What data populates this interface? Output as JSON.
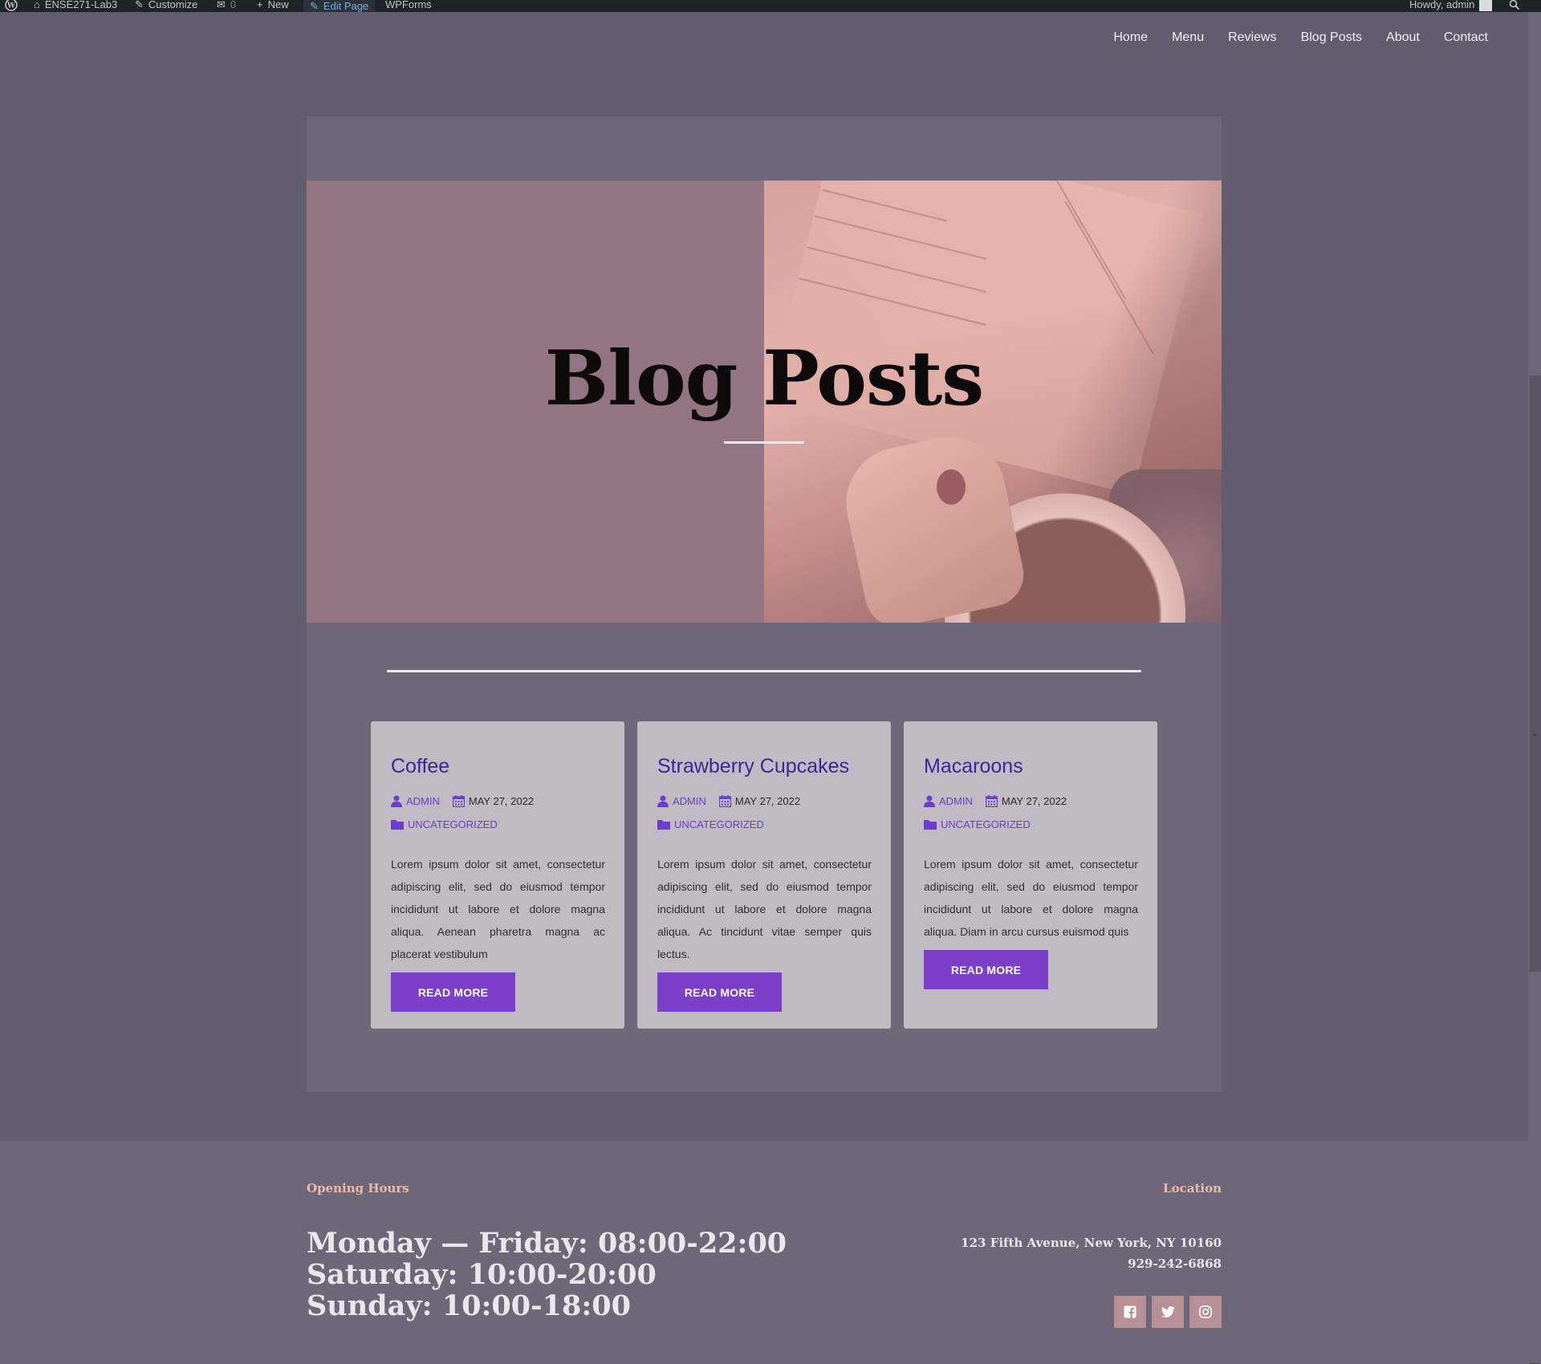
{
  "admin_bar": {
    "site_name": "ENSE271-Lab3",
    "customize": "Customize",
    "comments_count": "0",
    "new_label": "New",
    "edit_page": "Edit Page",
    "wpforms": "WPForms",
    "howdy": "Howdy, admin"
  },
  "nav": {
    "items": [
      "Home",
      "Menu",
      "Reviews",
      "Blog Posts",
      "About",
      "Contact"
    ]
  },
  "hero": {
    "title": "Blog Posts"
  },
  "posts": [
    {
      "title": "Coffee",
      "author": "ADMIN",
      "date": "MAY 27, 2022",
      "category": "UNCATEGORIZED",
      "excerpt": "Lorem ipsum dolor sit amet, consectetur adipiscing elit, sed do eiusmod tempor incididunt ut labore et dolore magna aliqua. Aenean pharetra magna ac placerat vestibulum",
      "button": "READ MORE"
    },
    {
      "title": "Strawberry Cupcakes",
      "author": "ADMIN",
      "date": "MAY 27, 2022",
      "category": "UNCATEGORIZED",
      "excerpt": "Lorem ipsum dolor sit amet, consectetur adipiscing elit, sed do eiusmod tempor incididunt ut labore et dolore magna aliqua. Ac tincidunt vitae semper quis lectus.",
      "button": "READ MORE"
    },
    {
      "title": "Macaroons",
      "author": "ADMIN",
      "date": "MAY 27, 2022",
      "category": "UNCATEGORIZED",
      "excerpt": "Lorem ipsum dolor sit amet, consectetur adipiscing elit, sed do eiusmod tempor incididunt ut labore et dolore magna aliqua. Diam in arcu cursus euismod quis",
      "button": "READ MORE"
    }
  ],
  "footer": {
    "hours_label": "Opening Hours",
    "hours": [
      "Monday — Friday: 08:00-22:00",
      "Saturday: 10:00-20:00",
      "Sunday: 10:00-18:00"
    ],
    "location_label": "Location",
    "address": "123 Fifth Avenue, New York, NY 10160",
    "phone": "929-242-6868",
    "social": [
      "facebook-icon",
      "twitter-icon",
      "instagram-icon"
    ]
  },
  "colors": {
    "page_bg": "#625c6c",
    "panel_bg": "#6d6778",
    "accent": "#7c3fc8",
    "title": "#3f2398",
    "footer_label": "#f3b7a5"
  }
}
